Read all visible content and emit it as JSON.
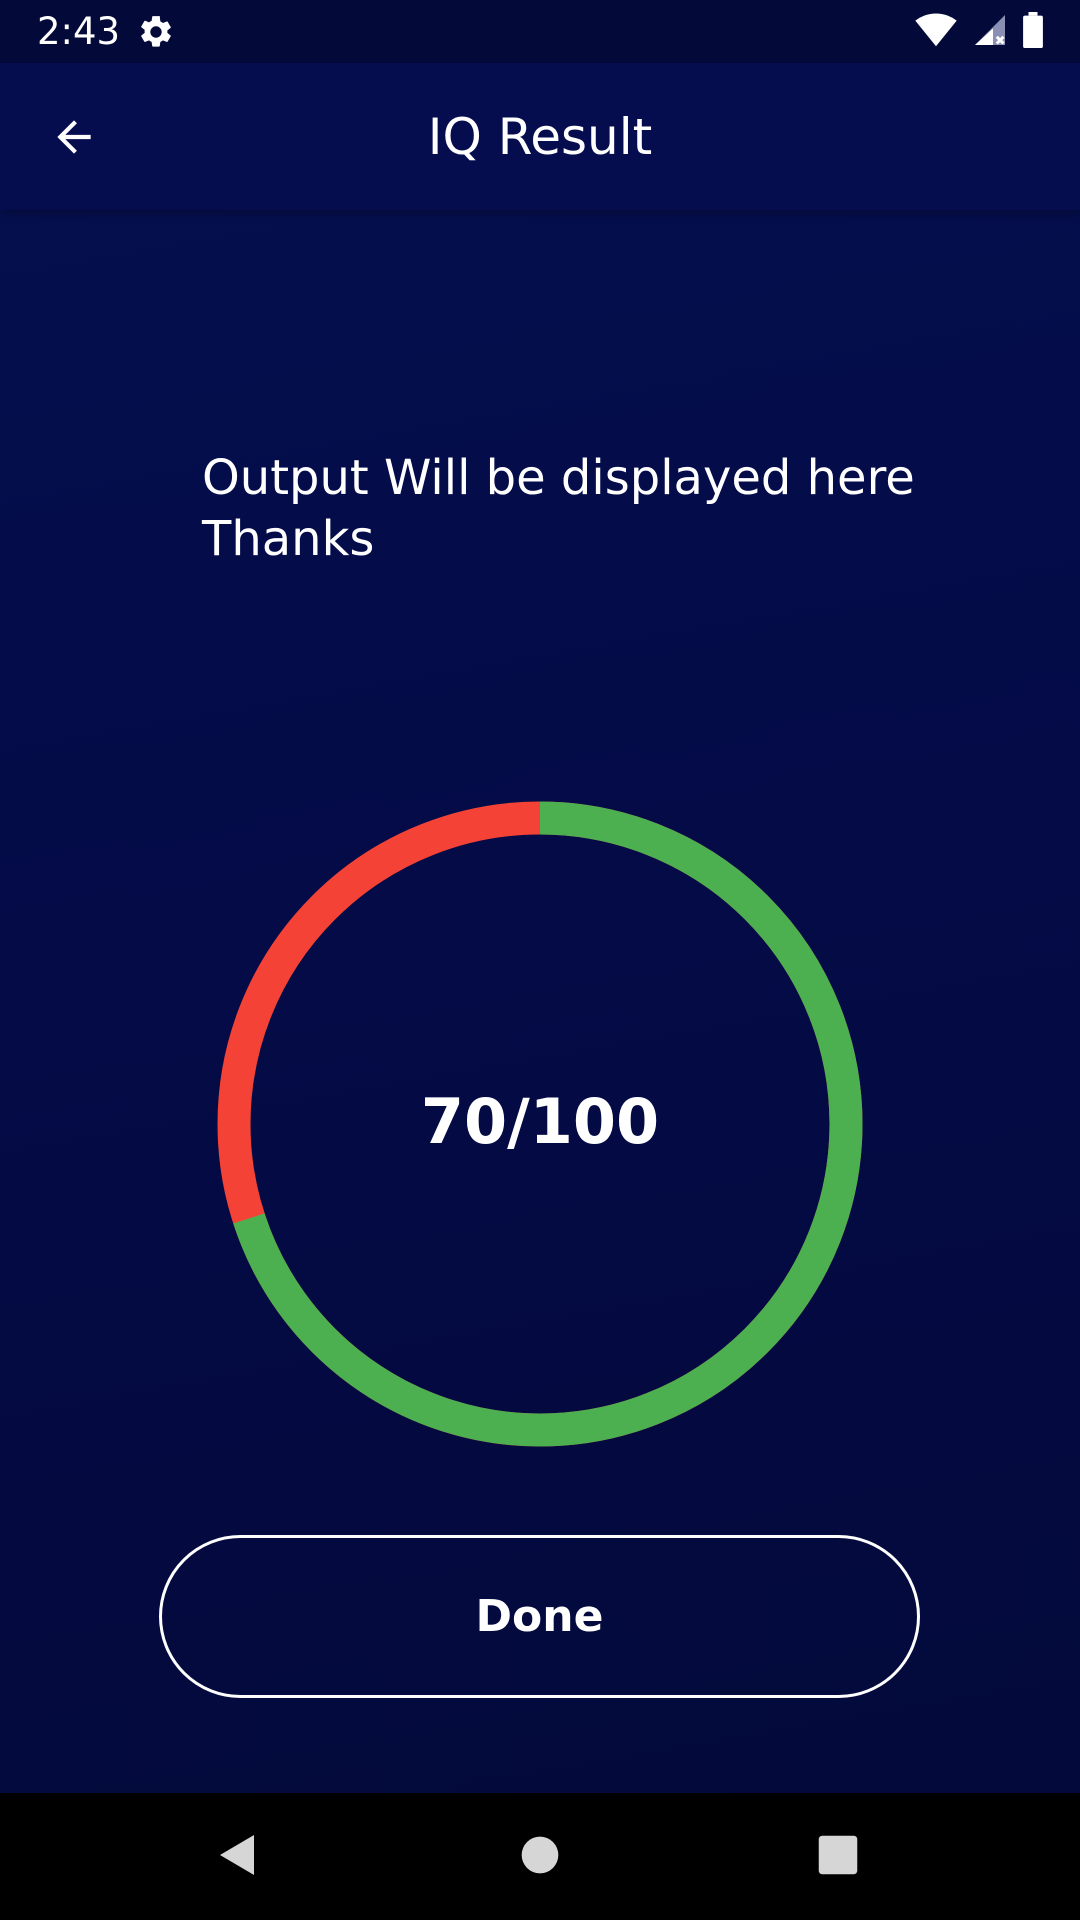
{
  "status_bar": {
    "time": "2:43",
    "icons": [
      "gear-icon",
      "wifi-icon",
      "signal-icon",
      "battery-icon"
    ]
  },
  "app_bar": {
    "title": "IQ Result",
    "back_icon": "arrow-back-icon"
  },
  "message": {
    "line1": "Output Will be displayed here",
    "line2": "Thanks"
  },
  "result": {
    "score_text": "70/100",
    "score": 70,
    "max": 100,
    "colors": {
      "correct": "#4caf50",
      "incorrect": "#f44336"
    }
  },
  "actions": {
    "done_label": "Done"
  },
  "nav_bar": {
    "icons": [
      "nav-back-icon",
      "nav-home-icon",
      "nav-recents-icon"
    ]
  },
  "colors": {
    "background": "#040b47",
    "app_bar": "#050d4f",
    "status_bar": "#030a3a"
  }
}
